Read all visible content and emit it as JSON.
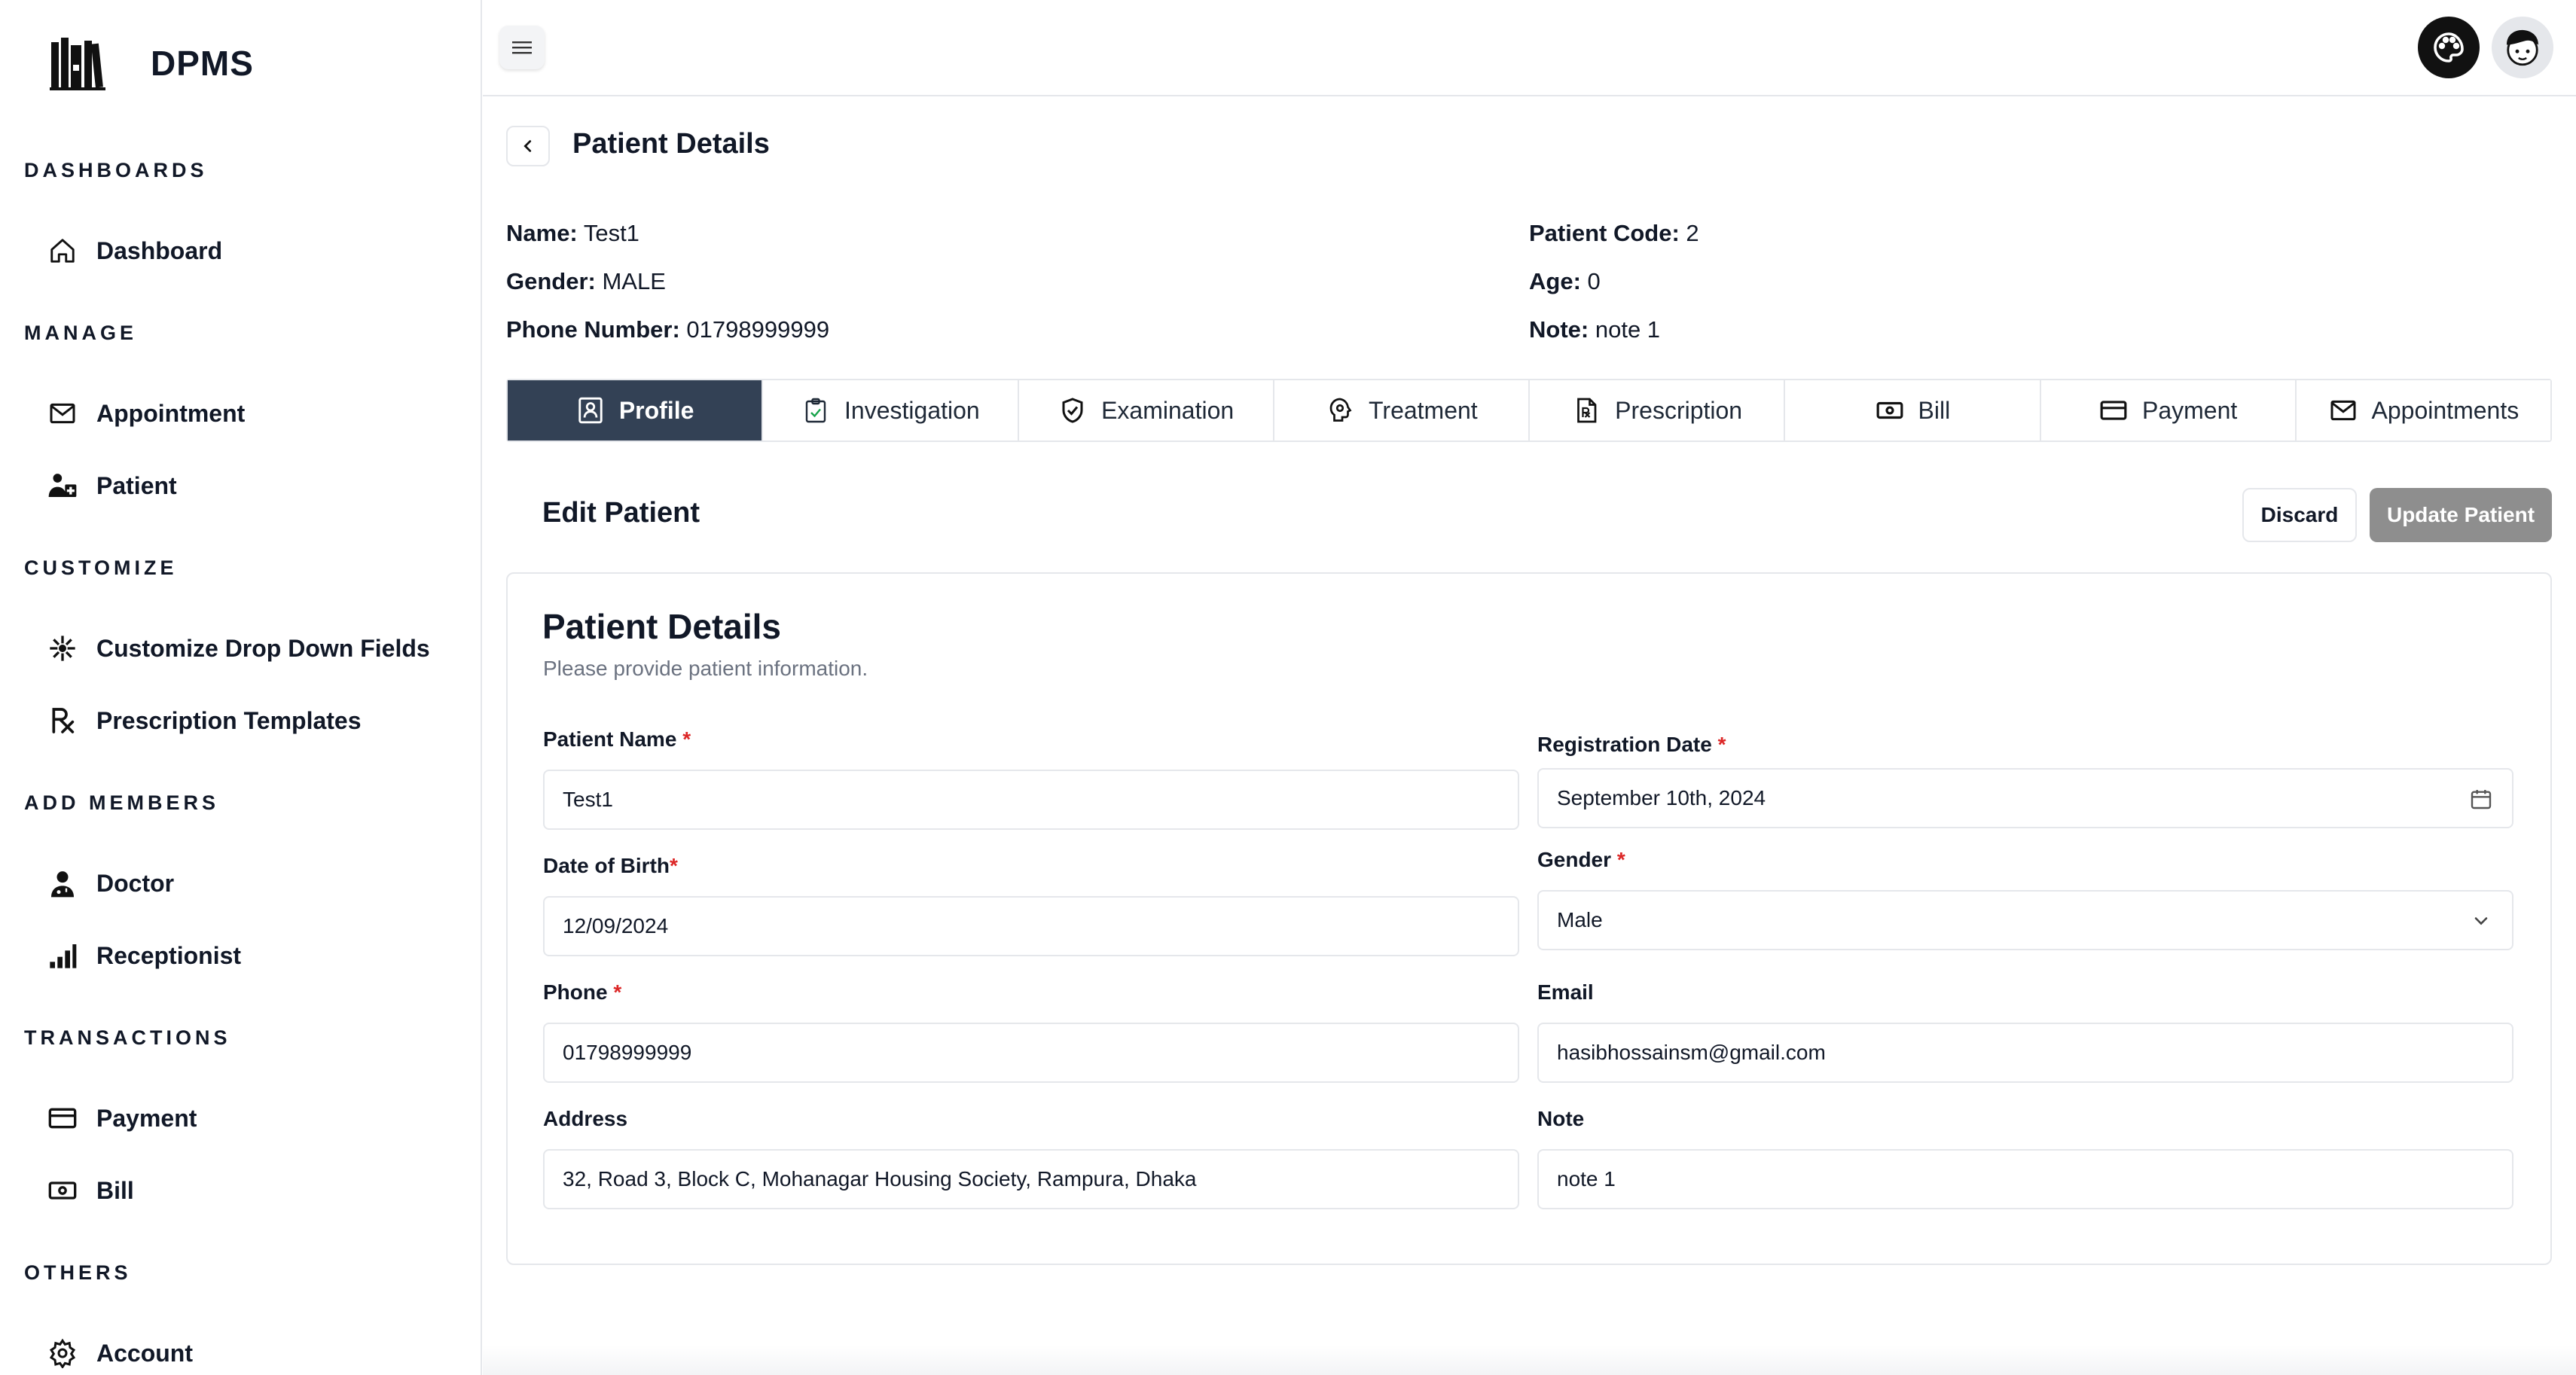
{
  "app": {
    "name": "DPMS"
  },
  "sidebar": {
    "sections": [
      {
        "title": "DASHBOARDS",
        "items": [
          {
            "label": "Dashboard",
            "icon": "home-icon"
          }
        ]
      },
      {
        "title": "MANAGE",
        "items": [
          {
            "label": "Appointment",
            "icon": "mail-icon"
          },
          {
            "label": "Patient",
            "icon": "patient-icon"
          }
        ]
      },
      {
        "title": "CUSTOMIZE",
        "items": [
          {
            "label": "Customize Drop Down Fields",
            "icon": "sparkle-icon"
          },
          {
            "label": "Prescription Templates",
            "icon": "rx-icon"
          }
        ]
      },
      {
        "title": "ADD MEMBERS",
        "items": [
          {
            "label": "Doctor",
            "icon": "doctor-icon"
          },
          {
            "label": "Receptionist",
            "icon": "signal-icon"
          }
        ]
      },
      {
        "title": "TRANSACTIONS",
        "items": [
          {
            "label": "Payment",
            "icon": "credit-card-icon"
          },
          {
            "label": "Bill",
            "icon": "banknote-icon"
          }
        ]
      },
      {
        "title": "OTHERS",
        "items": [
          {
            "label": "Account",
            "icon": "gear-icon"
          }
        ]
      }
    ]
  },
  "header": {
    "title": "Patient Details"
  },
  "patient_info": {
    "name_label": "Name:",
    "name": "Test1",
    "gender_label": "Gender:",
    "gender": "MALE",
    "phone_label": "Phone Number:",
    "phone": "01798999999",
    "code_label": "Patient Code:",
    "code": "2",
    "age_label": "Age:",
    "age": "0",
    "note_label": "Note:",
    "note": "note 1"
  },
  "tabs": [
    {
      "label": "Profile",
      "icon": "profile-icon",
      "active": true
    },
    {
      "label": "Investigation",
      "icon": "clipboard-check-icon"
    },
    {
      "label": "Examination",
      "icon": "shield-check-icon"
    },
    {
      "label": "Treatment",
      "icon": "brain-icon"
    },
    {
      "label": "Prescription",
      "icon": "file-rx-icon"
    },
    {
      "label": "Bill",
      "icon": "banknote-icon"
    },
    {
      "label": "Payment",
      "icon": "credit-card-icon"
    },
    {
      "label": "Appointments",
      "icon": "mail-icon"
    }
  ],
  "edit": {
    "title": "Edit Patient",
    "discard_label": "Discard",
    "update_label": "Update Patient"
  },
  "form": {
    "title": "Patient Details",
    "subtitle": "Please provide patient information.",
    "patient_name": {
      "label": "Patient Name",
      "required": "*",
      "value": "Test1"
    },
    "registration_date": {
      "label": "Registration Date",
      "required": "*",
      "value": "September 10th, 2024"
    },
    "dob": {
      "label": "Date of Birth",
      "required": "*",
      "value": "12/09/2024"
    },
    "gender": {
      "label": "Gender",
      "required": "*",
      "value": "Male"
    },
    "phone": {
      "label": "Phone",
      "required": "*",
      "value": "01798999999"
    },
    "email": {
      "label": "Email",
      "value": "hasibhossainsm@gmail.com"
    },
    "address": {
      "label": "Address",
      "value": "32, Road 3, Block C, Mohanagar Housing Society, Rampura, Dhaka"
    },
    "note": {
      "label": "Note",
      "value": "note 1"
    }
  },
  "colors": {
    "active_tab": "#334155",
    "update_button": "#8e8e8e",
    "required": "#dc2626"
  }
}
